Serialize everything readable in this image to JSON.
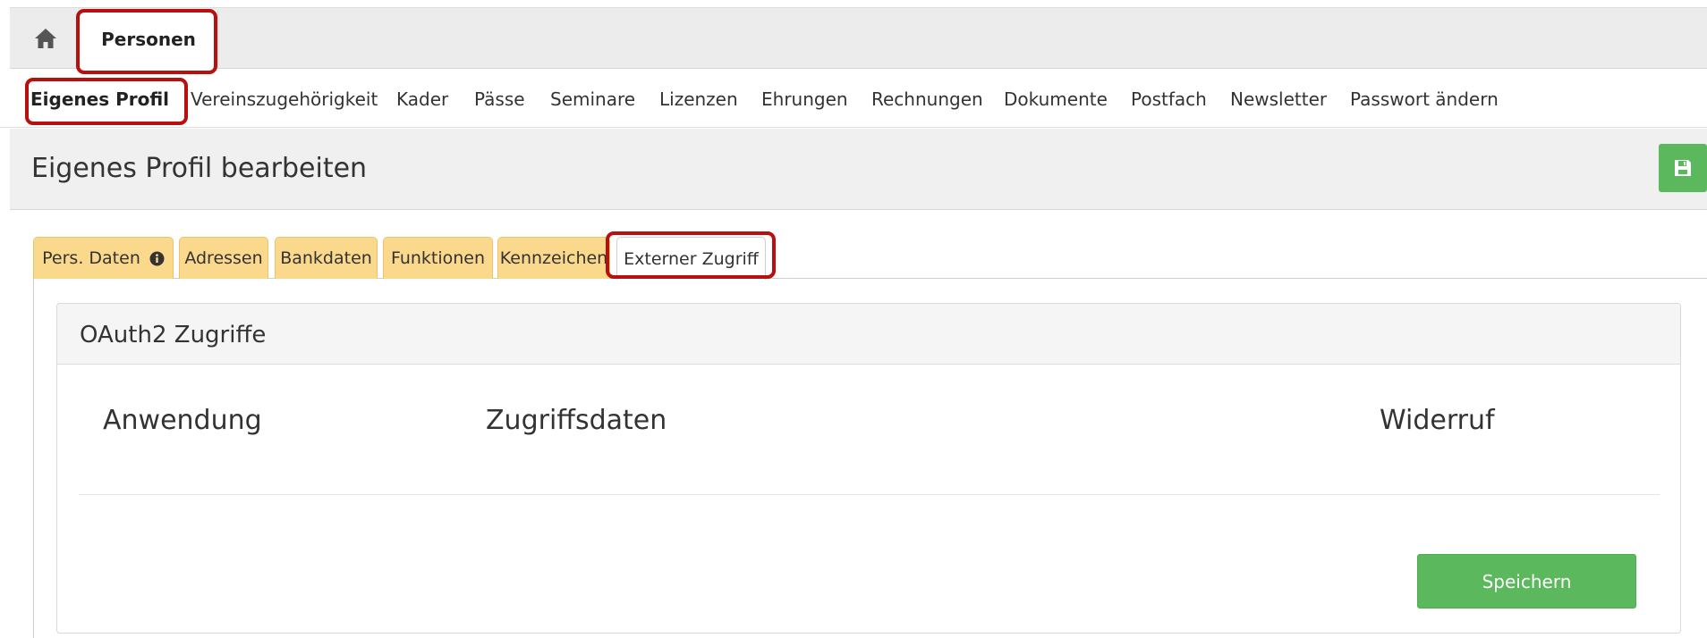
{
  "topbar": {
    "home_icon": "home-icon",
    "module_tab": "Personen"
  },
  "subnav": {
    "items": [
      {
        "label": "Eigenes Profil",
        "active": true
      },
      {
        "label": "Vereinszugehörigkeit"
      },
      {
        "label": "Kader"
      },
      {
        "label": "Pässe"
      },
      {
        "label": "Seminare"
      },
      {
        "label": "Lizenzen"
      },
      {
        "label": "Ehrungen"
      },
      {
        "label": "Rechnungen"
      },
      {
        "label": "Dokumente"
      },
      {
        "label": "Postfach"
      },
      {
        "label": "Newsletter"
      },
      {
        "label": "Passwort ändern"
      }
    ]
  },
  "header": {
    "title": "Eigenes Profil bearbeiten",
    "save_icon": "save-icon"
  },
  "tabs": [
    {
      "label": "Pers. Daten",
      "icon": "info-circle-icon"
    },
    {
      "label": "Adressen"
    },
    {
      "label": "Bankdaten"
    },
    {
      "label": "Funktionen"
    },
    {
      "label": "Kennzeichen"
    },
    {
      "label": "Externer Zugriff",
      "active": true
    }
  ],
  "card": {
    "title": "OAuth2 Zugriffe",
    "columns": [
      "Anwendung",
      "Zugriffsdaten",
      "Widerruf"
    ],
    "save_label": "Speichern"
  },
  "colors": {
    "accent_green": "#5cb85c",
    "tab_yellow": "#fbd98c",
    "highlight_red": "#b80f0f"
  }
}
